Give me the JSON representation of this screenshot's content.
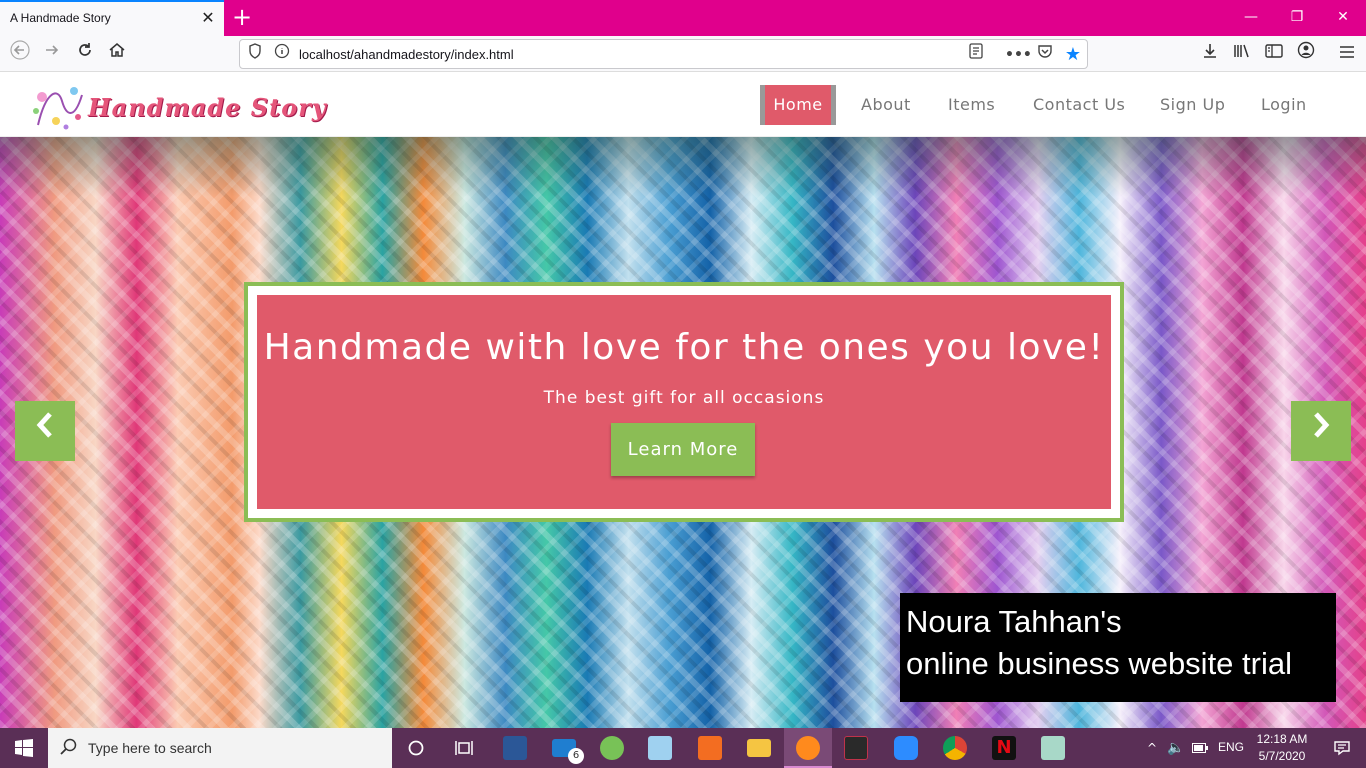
{
  "browser": {
    "tab_title": "A Handmade Story",
    "tab_close": "✕",
    "new_tab": "+",
    "window_buttons": [
      "—",
      "❐",
      "✕"
    ],
    "url": "localhost/ahandmadestory/index.html",
    "accent": "#e0008c"
  },
  "site": {
    "logo_text": "Handmade Story",
    "nav": [
      "Home",
      "About",
      "Items",
      "Contact Us",
      "Sign Up",
      "Login"
    ],
    "active_nav": "Home",
    "colors": {
      "pink": "#e05a6a",
      "green": "#8bbd55"
    }
  },
  "hero": {
    "title": "Handmade with love for the ones you love!",
    "subtitle": "The best gift for all occasions",
    "button": "Learn More",
    "prev_icon": "‹",
    "next_icon": "›"
  },
  "overlay": {
    "line1": "Noura Tahhan's",
    "line2": "online business website trial"
  },
  "taskbar": {
    "search_placeholder": "Type here to search",
    "mail_badge": "6",
    "language": "ENG",
    "time": "12:18 AM",
    "date": "5/7/2020"
  }
}
